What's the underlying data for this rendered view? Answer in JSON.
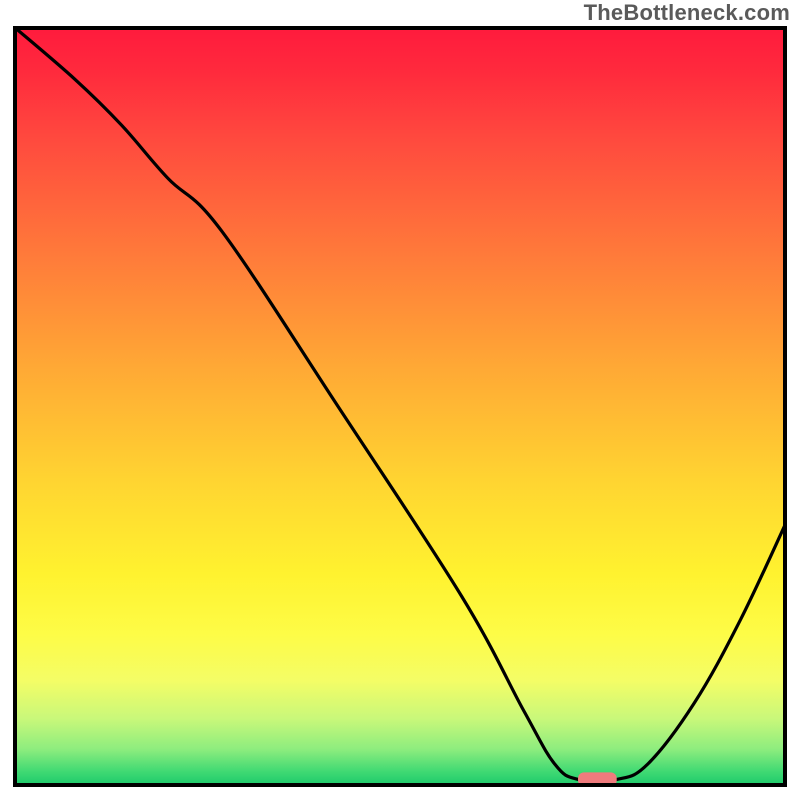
{
  "watermark_text": "TheBottleneck.com",
  "chart_data": {
    "type": "line",
    "title": "",
    "xlabel": "",
    "ylabel": "",
    "x_range": [
      0,
      100
    ],
    "y_range": [
      0,
      100
    ],
    "series": [
      {
        "name": "bottleneck-curve",
        "x": [
          0,
          8,
          14,
          20,
          27,
          42,
          58,
          66,
          70,
          73,
          78,
          82,
          88,
          94,
          100
        ],
        "y": [
          100,
          93,
          87,
          80,
          73,
          50,
          25,
          10,
          3,
          1,
          1,
          3,
          11,
          22,
          35
        ]
      }
    ],
    "marker": {
      "name": "optimal-range",
      "x_start": 73,
      "x_end": 78,
      "y": 1
    },
    "background_gradient": {
      "top": "#ff1a3d",
      "mid": "#fff22f",
      "bottom": "#18c86a"
    },
    "grid": false,
    "legend": false
  }
}
